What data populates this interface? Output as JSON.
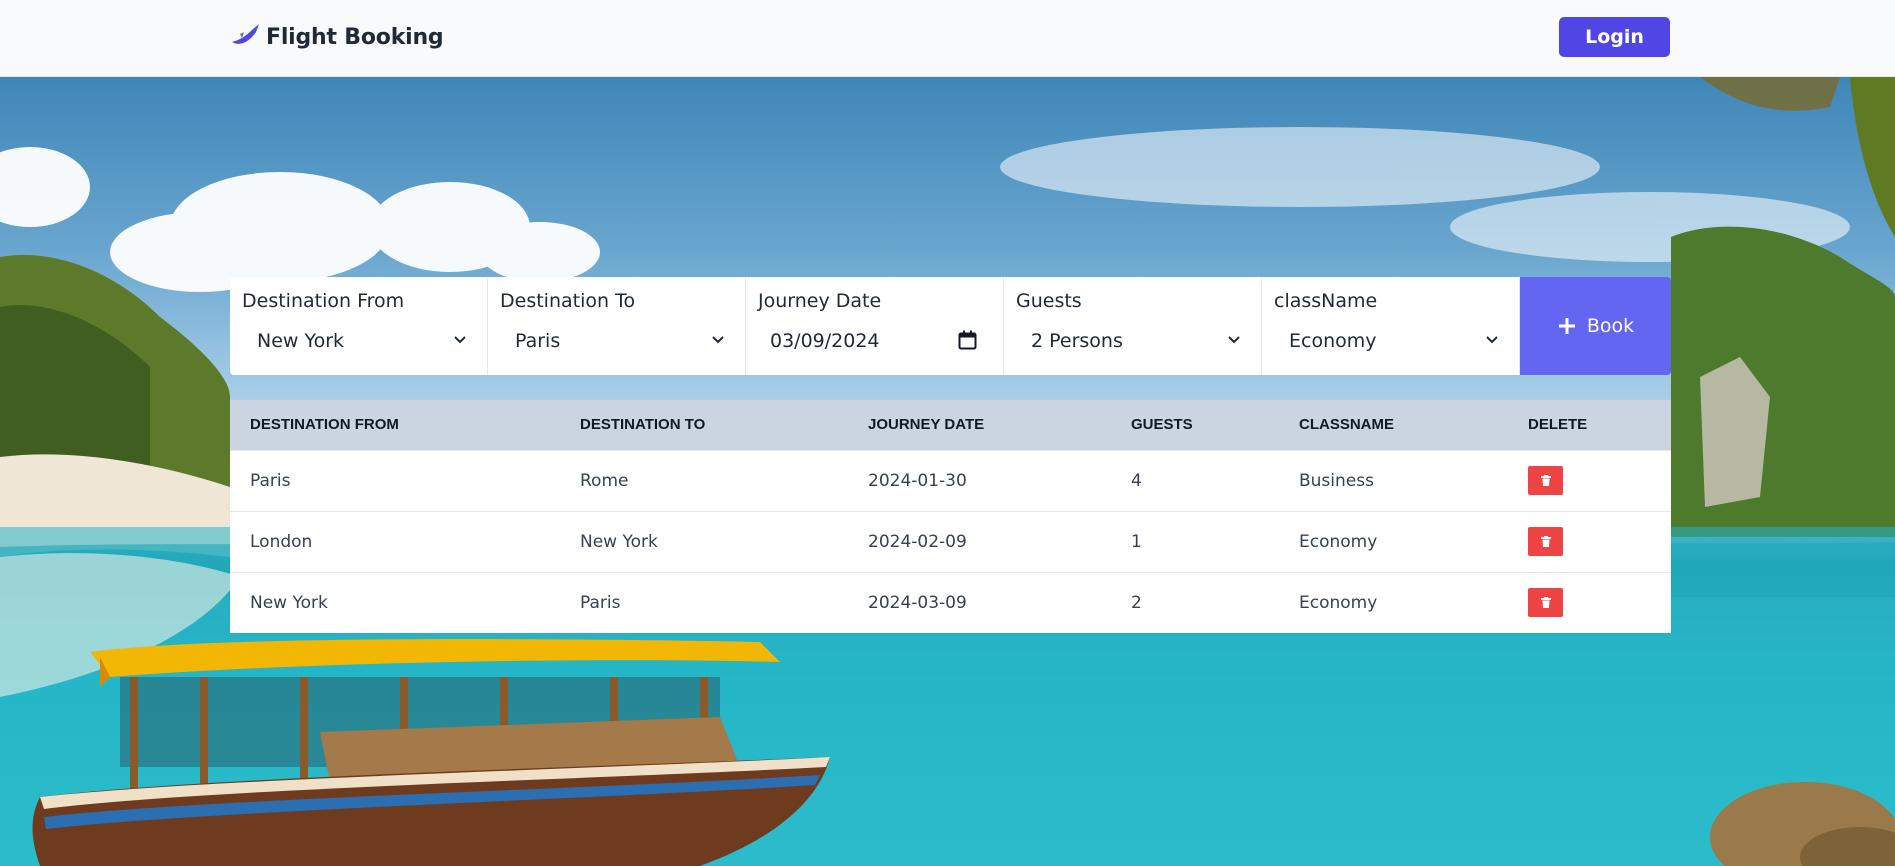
{
  "header": {
    "brand": "Flight Booking",
    "login_label": "Login"
  },
  "form": {
    "fields": [
      {
        "label": "Destination From",
        "value": "New York",
        "control": "select"
      },
      {
        "label": "Destination To",
        "value": "Paris",
        "control": "select"
      },
      {
        "label": "Journey Date",
        "value": "03/09/2024",
        "control": "date"
      },
      {
        "label": "Guests",
        "value": "2 Persons",
        "control": "select"
      },
      {
        "label": "className",
        "value": "Economy",
        "control": "select"
      }
    ],
    "book_label": "Book"
  },
  "table": {
    "headers": [
      "DESTINATION FROM",
      "DESTINATION TO",
      "JOURNEY DATE",
      "GUESTS",
      "CLASSNAME",
      "DELETE"
    ],
    "rows": [
      [
        "Paris",
        "Rome",
        "2024-01-30",
        "4",
        "Business"
      ],
      [
        "London",
        "New York",
        "2024-02-09",
        "1",
        "Economy"
      ],
      [
        "New York",
        "Paris",
        "2024-03-09",
        "2",
        "Economy"
      ]
    ]
  },
  "colors": {
    "brand": "#4f46e5",
    "book_button": "#6366f1",
    "delete_button": "#ef4444",
    "table_header": "#cbd5e1"
  },
  "icons": {
    "brand": "plane-icon",
    "dropdown": "chevron-down-icon",
    "date": "calendar-icon",
    "book": "plus-icon",
    "delete": "trash-icon"
  }
}
